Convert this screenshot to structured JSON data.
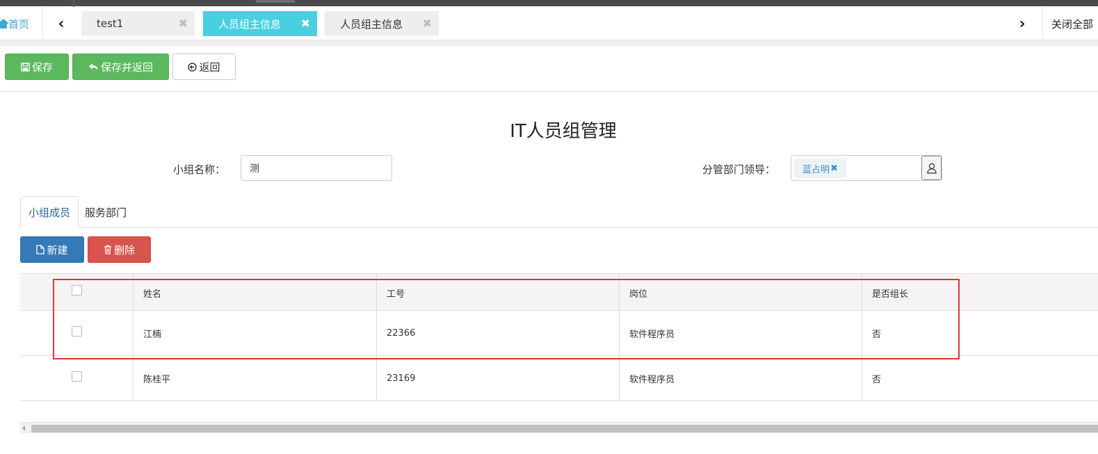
{
  "tabbar": {
    "home_label": "首页",
    "prev_icon": "chevron-left-icon",
    "next_icon": "chevron-right-icon",
    "tabs": [
      {
        "label": "test1",
        "close": "✖"
      },
      {
        "label": "人员组主信息",
        "close": "✖"
      },
      {
        "label": "人员组主信息",
        "close": "✖"
      }
    ],
    "active_tab_color": "#48d0e0",
    "close_all_label": "关闭全部"
  },
  "toolbar": {
    "save_label": "保存",
    "save_return_label": "保存并返回",
    "back_label": "返回"
  },
  "page": {
    "title": "IT人员组管理"
  },
  "form": {
    "group_name_label": "小组名称：",
    "group_name_value": "测",
    "leader_label": "分管部门领导：",
    "leader_tag": "蓝占明",
    "leader_tag_remove": "✖"
  },
  "subtabs": {
    "members_label": "小组成员",
    "departments_label": "服务部门"
  },
  "actions": {
    "new_label": "新建",
    "delete_label": "删除"
  },
  "table": {
    "headers": {
      "name": "姓名",
      "employee_id": "工号",
      "position": "岗位",
      "is_leader": "是否组长"
    },
    "rows": [
      {
        "name": "江楠",
        "employee_id": "22366",
        "position": "软件程序员",
        "is_leader": "否"
      },
      {
        "name": "陈桂平",
        "employee_id": "23169",
        "position": "软件程序员",
        "is_leader": "否"
      }
    ]
  },
  "colors": {
    "green": "#5cb85c",
    "blue": "#337ab7",
    "red": "#d9534f",
    "highlight": "#e8322c"
  }
}
